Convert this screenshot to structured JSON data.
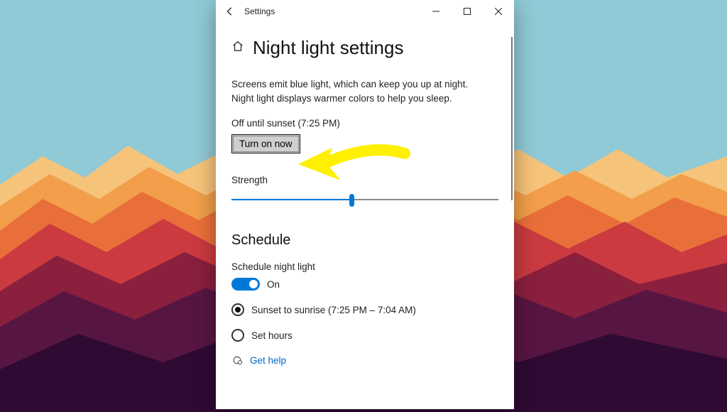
{
  "titlebar": {
    "app_title": "Settings"
  },
  "page": {
    "title": "Night light settings",
    "description": "Screens emit blue light, which can keep you up at night. Night light displays warmer colors to help you sleep.",
    "status": "Off until sunset (7:25 PM)",
    "turn_on_label": "Turn on now",
    "strength_label": "Strength",
    "strength_value_pct": 45
  },
  "schedule": {
    "heading": "Schedule",
    "toggle_label": "Schedule night light",
    "toggle_state": "On",
    "option_sunset": "Sunset to sunrise (7:25 PM – 7:04 AM)",
    "option_set_hours": "Set hours",
    "selected": "sunset"
  },
  "help": {
    "label": "Get help"
  },
  "colors": {
    "accent": "#0078d7",
    "link": "#0067c0",
    "annotation": "#ffef00"
  }
}
